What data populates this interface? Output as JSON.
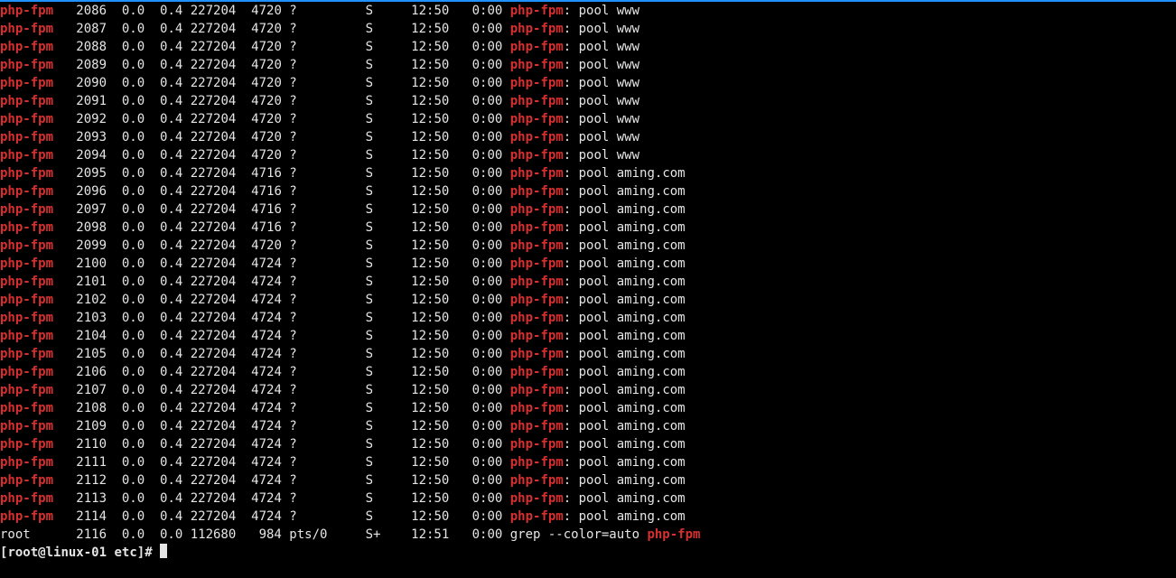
{
  "colors": {
    "highlight": "#d73030",
    "fg": "#e5e5e5",
    "bg": "#000000",
    "border_top": "#1e90ff"
  },
  "prompt": {
    "user": "root",
    "host": "linux-01",
    "cwd": "etc",
    "symbol": "#"
  },
  "processes": [
    {
      "user": "php-fpm",
      "pid": "2086",
      "cpu": "0.0",
      "mem": "0.4",
      "vsz": "227204",
      "rss": "4720",
      "tty": "?",
      "stat": "S",
      "start": "12:50",
      "time": "0:00",
      "cmd_hl": "php-fpm",
      "cmd_rest": ": pool www"
    },
    {
      "user": "php-fpm",
      "pid": "2087",
      "cpu": "0.0",
      "mem": "0.4",
      "vsz": "227204",
      "rss": "4720",
      "tty": "?",
      "stat": "S",
      "start": "12:50",
      "time": "0:00",
      "cmd_hl": "php-fpm",
      "cmd_rest": ": pool www"
    },
    {
      "user": "php-fpm",
      "pid": "2088",
      "cpu": "0.0",
      "mem": "0.4",
      "vsz": "227204",
      "rss": "4720",
      "tty": "?",
      "stat": "S",
      "start": "12:50",
      "time": "0:00",
      "cmd_hl": "php-fpm",
      "cmd_rest": ": pool www"
    },
    {
      "user": "php-fpm",
      "pid": "2089",
      "cpu": "0.0",
      "mem": "0.4",
      "vsz": "227204",
      "rss": "4720",
      "tty": "?",
      "stat": "S",
      "start": "12:50",
      "time": "0:00",
      "cmd_hl": "php-fpm",
      "cmd_rest": ": pool www"
    },
    {
      "user": "php-fpm",
      "pid": "2090",
      "cpu": "0.0",
      "mem": "0.4",
      "vsz": "227204",
      "rss": "4720",
      "tty": "?",
      "stat": "S",
      "start": "12:50",
      "time": "0:00",
      "cmd_hl": "php-fpm",
      "cmd_rest": ": pool www"
    },
    {
      "user": "php-fpm",
      "pid": "2091",
      "cpu": "0.0",
      "mem": "0.4",
      "vsz": "227204",
      "rss": "4720",
      "tty": "?",
      "stat": "S",
      "start": "12:50",
      "time": "0:00",
      "cmd_hl": "php-fpm",
      "cmd_rest": ": pool www"
    },
    {
      "user": "php-fpm",
      "pid": "2092",
      "cpu": "0.0",
      "mem": "0.4",
      "vsz": "227204",
      "rss": "4720",
      "tty": "?",
      "stat": "S",
      "start": "12:50",
      "time": "0:00",
      "cmd_hl": "php-fpm",
      "cmd_rest": ": pool www"
    },
    {
      "user": "php-fpm",
      "pid": "2093",
      "cpu": "0.0",
      "mem": "0.4",
      "vsz": "227204",
      "rss": "4720",
      "tty": "?",
      "stat": "S",
      "start": "12:50",
      "time": "0:00",
      "cmd_hl": "php-fpm",
      "cmd_rest": ": pool www"
    },
    {
      "user": "php-fpm",
      "pid": "2094",
      "cpu": "0.0",
      "mem": "0.4",
      "vsz": "227204",
      "rss": "4720",
      "tty": "?",
      "stat": "S",
      "start": "12:50",
      "time": "0:00",
      "cmd_hl": "php-fpm",
      "cmd_rest": ": pool www"
    },
    {
      "user": "php-fpm",
      "pid": "2095",
      "cpu": "0.0",
      "mem": "0.4",
      "vsz": "227204",
      "rss": "4716",
      "tty": "?",
      "stat": "S",
      "start": "12:50",
      "time": "0:00",
      "cmd_hl": "php-fpm",
      "cmd_rest": ": pool aming.com"
    },
    {
      "user": "php-fpm",
      "pid": "2096",
      "cpu": "0.0",
      "mem": "0.4",
      "vsz": "227204",
      "rss": "4716",
      "tty": "?",
      "stat": "S",
      "start": "12:50",
      "time": "0:00",
      "cmd_hl": "php-fpm",
      "cmd_rest": ": pool aming.com"
    },
    {
      "user": "php-fpm",
      "pid": "2097",
      "cpu": "0.0",
      "mem": "0.4",
      "vsz": "227204",
      "rss": "4716",
      "tty": "?",
      "stat": "S",
      "start": "12:50",
      "time": "0:00",
      "cmd_hl": "php-fpm",
      "cmd_rest": ": pool aming.com"
    },
    {
      "user": "php-fpm",
      "pid": "2098",
      "cpu": "0.0",
      "mem": "0.4",
      "vsz": "227204",
      "rss": "4716",
      "tty": "?",
      "stat": "S",
      "start": "12:50",
      "time": "0:00",
      "cmd_hl": "php-fpm",
      "cmd_rest": ": pool aming.com"
    },
    {
      "user": "php-fpm",
      "pid": "2099",
      "cpu": "0.0",
      "mem": "0.4",
      "vsz": "227204",
      "rss": "4720",
      "tty": "?",
      "stat": "S",
      "start": "12:50",
      "time": "0:00",
      "cmd_hl": "php-fpm",
      "cmd_rest": ": pool aming.com"
    },
    {
      "user": "php-fpm",
      "pid": "2100",
      "cpu": "0.0",
      "mem": "0.4",
      "vsz": "227204",
      "rss": "4724",
      "tty": "?",
      "stat": "S",
      "start": "12:50",
      "time": "0:00",
      "cmd_hl": "php-fpm",
      "cmd_rest": ": pool aming.com"
    },
    {
      "user": "php-fpm",
      "pid": "2101",
      "cpu": "0.0",
      "mem": "0.4",
      "vsz": "227204",
      "rss": "4724",
      "tty": "?",
      "stat": "S",
      "start": "12:50",
      "time": "0:00",
      "cmd_hl": "php-fpm",
      "cmd_rest": ": pool aming.com"
    },
    {
      "user": "php-fpm",
      "pid": "2102",
      "cpu": "0.0",
      "mem": "0.4",
      "vsz": "227204",
      "rss": "4724",
      "tty": "?",
      "stat": "S",
      "start": "12:50",
      "time": "0:00",
      "cmd_hl": "php-fpm",
      "cmd_rest": ": pool aming.com"
    },
    {
      "user": "php-fpm",
      "pid": "2103",
      "cpu": "0.0",
      "mem": "0.4",
      "vsz": "227204",
      "rss": "4724",
      "tty": "?",
      "stat": "S",
      "start": "12:50",
      "time": "0:00",
      "cmd_hl": "php-fpm",
      "cmd_rest": ": pool aming.com"
    },
    {
      "user": "php-fpm",
      "pid": "2104",
      "cpu": "0.0",
      "mem": "0.4",
      "vsz": "227204",
      "rss": "4724",
      "tty": "?",
      "stat": "S",
      "start": "12:50",
      "time": "0:00",
      "cmd_hl": "php-fpm",
      "cmd_rest": ": pool aming.com"
    },
    {
      "user": "php-fpm",
      "pid": "2105",
      "cpu": "0.0",
      "mem": "0.4",
      "vsz": "227204",
      "rss": "4724",
      "tty": "?",
      "stat": "S",
      "start": "12:50",
      "time": "0:00",
      "cmd_hl": "php-fpm",
      "cmd_rest": ": pool aming.com"
    },
    {
      "user": "php-fpm",
      "pid": "2106",
      "cpu": "0.0",
      "mem": "0.4",
      "vsz": "227204",
      "rss": "4724",
      "tty": "?",
      "stat": "S",
      "start": "12:50",
      "time": "0:00",
      "cmd_hl": "php-fpm",
      "cmd_rest": ": pool aming.com"
    },
    {
      "user": "php-fpm",
      "pid": "2107",
      "cpu": "0.0",
      "mem": "0.4",
      "vsz": "227204",
      "rss": "4724",
      "tty": "?",
      "stat": "S",
      "start": "12:50",
      "time": "0:00",
      "cmd_hl": "php-fpm",
      "cmd_rest": ": pool aming.com"
    },
    {
      "user": "php-fpm",
      "pid": "2108",
      "cpu": "0.0",
      "mem": "0.4",
      "vsz": "227204",
      "rss": "4724",
      "tty": "?",
      "stat": "S",
      "start": "12:50",
      "time": "0:00",
      "cmd_hl": "php-fpm",
      "cmd_rest": ": pool aming.com"
    },
    {
      "user": "php-fpm",
      "pid": "2109",
      "cpu": "0.0",
      "mem": "0.4",
      "vsz": "227204",
      "rss": "4724",
      "tty": "?",
      "stat": "S",
      "start": "12:50",
      "time": "0:00",
      "cmd_hl": "php-fpm",
      "cmd_rest": ": pool aming.com"
    },
    {
      "user": "php-fpm",
      "pid": "2110",
      "cpu": "0.0",
      "mem": "0.4",
      "vsz": "227204",
      "rss": "4724",
      "tty": "?",
      "stat": "S",
      "start": "12:50",
      "time": "0:00",
      "cmd_hl": "php-fpm",
      "cmd_rest": ": pool aming.com"
    },
    {
      "user": "php-fpm",
      "pid": "2111",
      "cpu": "0.0",
      "mem": "0.4",
      "vsz": "227204",
      "rss": "4724",
      "tty": "?",
      "stat": "S",
      "start": "12:50",
      "time": "0:00",
      "cmd_hl": "php-fpm",
      "cmd_rest": ": pool aming.com"
    },
    {
      "user": "php-fpm",
      "pid": "2112",
      "cpu": "0.0",
      "mem": "0.4",
      "vsz": "227204",
      "rss": "4724",
      "tty": "?",
      "stat": "S",
      "start": "12:50",
      "time": "0:00",
      "cmd_hl": "php-fpm",
      "cmd_rest": ": pool aming.com"
    },
    {
      "user": "php-fpm",
      "pid": "2113",
      "cpu": "0.0",
      "mem": "0.4",
      "vsz": "227204",
      "rss": "4724",
      "tty": "?",
      "stat": "S",
      "start": "12:50",
      "time": "0:00",
      "cmd_hl": "php-fpm",
      "cmd_rest": ": pool aming.com"
    },
    {
      "user": "php-fpm",
      "pid": "2114",
      "cpu": "0.0",
      "mem": "0.4",
      "vsz": "227204",
      "rss": "4724",
      "tty": "?",
      "stat": "S",
      "start": "12:50",
      "time": "0:00",
      "cmd_hl": "php-fpm",
      "cmd_rest": ": pool aming.com"
    },
    {
      "user": "root",
      "pid": "2116",
      "cpu": "0.0",
      "mem": "0.0",
      "vsz": "112680",
      "rss": "984",
      "tty": "pts/0",
      "stat": "S+",
      "start": "12:51",
      "time": "0:00",
      "cmd_pre": "grep --color=auto ",
      "cmd_hl": "php-fpm",
      "cmd_rest": ""
    }
  ]
}
